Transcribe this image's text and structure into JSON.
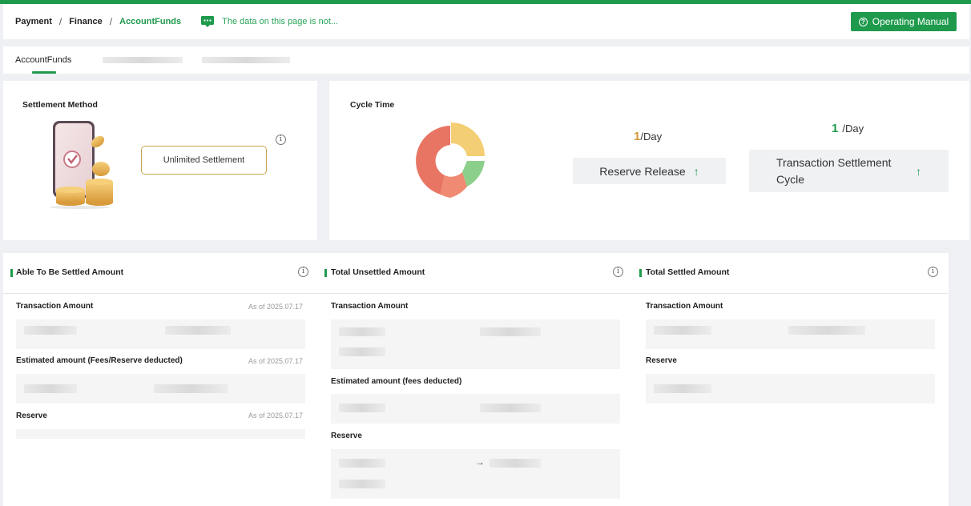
{
  "breadcrumb": {
    "items": [
      "Payment",
      "Finance",
      "AccountFunds"
    ],
    "separator": "/"
  },
  "notice": {
    "text": "The data on this page is not..."
  },
  "header": {
    "manual_button": "Operating Manual"
  },
  "tabs": {
    "active": "AccountFunds"
  },
  "settlement": {
    "title": "Settlement Method",
    "button": "Unlimited Settlement",
    "info": "i"
  },
  "cycle": {
    "title": "Cycle Time",
    "reserve": {
      "value": "1",
      "unit": "/Day",
      "label": "Reserve Release",
      "arrow": "↑"
    },
    "transaction": {
      "value": "1",
      "unit": "/Day",
      "label": "Transaction Settlement Cycle",
      "arrow": "↑"
    }
  },
  "sections": {
    "able": {
      "title": "Able To Be Settled Amount",
      "info": "i",
      "transaction_label": "Transaction Amount",
      "transaction_date": "As of 2025.07.17",
      "estimated_label": "Estimated amount (Fees/Reserve deducted)",
      "estimated_date": "As of 2025.07.17",
      "reserve_label": "Reserve",
      "reserve_date": "As of 2025.07.17"
    },
    "unsettled": {
      "title": "Total Unsettled Amount",
      "info": "i",
      "transaction_label": "Transaction Amount",
      "estimated_label": "Estimated amount (fees deducted)",
      "reserve_label": "Reserve",
      "reserve_arrow": "→"
    },
    "settled": {
      "title": "Total Settled Amount",
      "info": "i",
      "transaction_label": "Transaction Amount",
      "reserve_label": "Reserve"
    }
  },
  "colors": {
    "brand": "#1f9a4d",
    "accent_gold": "#c9a24a",
    "reserve_value": "#d29a3a"
  }
}
